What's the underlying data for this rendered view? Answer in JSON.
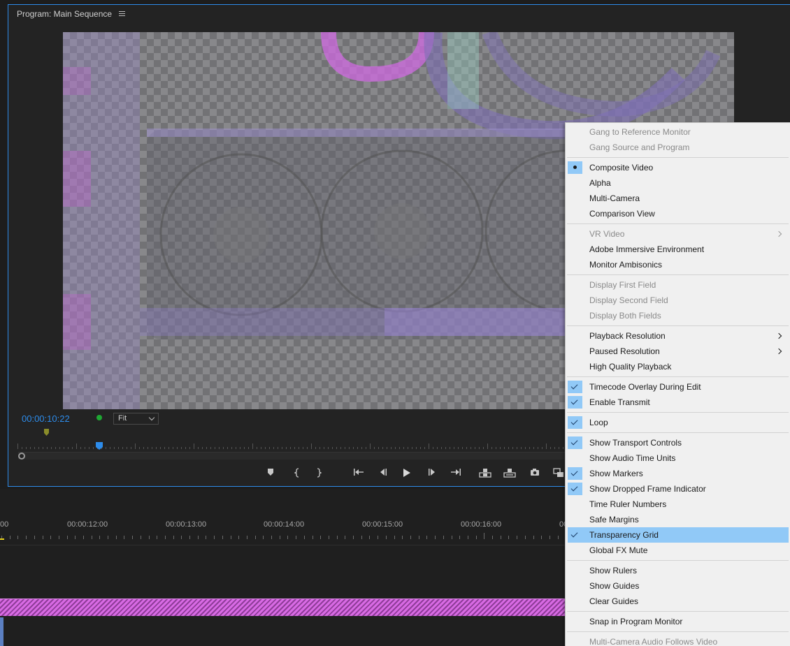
{
  "panel": {
    "title": "Program: Main Sequence"
  },
  "playback": {
    "timecode": "00:00:10:22",
    "zoom": "Fit"
  },
  "timeline": {
    "labels": [
      "00",
      "00:00:12:00",
      "00:00:13:00",
      "00:00:14:00",
      "00:00:15:00",
      "00:00:16:00",
      "00"
    ]
  },
  "menu": {
    "groups": [
      [
        {
          "label": "Gang to Reference Monitor",
          "disabled": true
        },
        {
          "label": "Gang Source and Program",
          "disabled": true
        }
      ],
      [
        {
          "label": "Composite Video",
          "mark": "dot"
        },
        {
          "label": "Alpha"
        },
        {
          "label": "Multi-Camera"
        },
        {
          "label": "Comparison View"
        }
      ],
      [
        {
          "label": "VR Video",
          "disabled": true,
          "submenu": true
        },
        {
          "label": "Adobe Immersive Environment"
        },
        {
          "label": "Monitor Ambisonics"
        }
      ],
      [
        {
          "label": "Display First Field",
          "disabled": true
        },
        {
          "label": "Display Second Field",
          "disabled": true
        },
        {
          "label": "Display Both Fields",
          "disabled": true
        }
      ],
      [
        {
          "label": "Playback Resolution",
          "submenu": true
        },
        {
          "label": "Paused Resolution",
          "submenu": true
        },
        {
          "label": "High Quality Playback"
        }
      ],
      [
        {
          "label": "Timecode Overlay During Edit",
          "mark": "check"
        },
        {
          "label": "Enable Transmit",
          "mark": "check"
        }
      ],
      [
        {
          "label": "Loop",
          "mark": "check"
        }
      ],
      [
        {
          "label": "Show Transport Controls",
          "mark": "check"
        },
        {
          "label": "Show Audio Time Units"
        },
        {
          "label": "Show Markers",
          "mark": "check"
        },
        {
          "label": "Show Dropped Frame Indicator",
          "mark": "check"
        },
        {
          "label": "Time Ruler Numbers"
        },
        {
          "label": "Safe Margins"
        },
        {
          "label": "Transparency Grid",
          "mark": "check",
          "highlighted": true
        },
        {
          "label": "Global FX Mute"
        }
      ],
      [
        {
          "label": "Show Rulers"
        },
        {
          "label": "Show Guides"
        },
        {
          "label": "Clear Guides"
        }
      ],
      [
        {
          "label": "Snap in Program Monitor"
        }
      ],
      [
        {
          "label": "Multi-Camera Audio Follows Video",
          "disabled": true
        }
      ]
    ]
  },
  "transport_icons": [
    "add-marker-icon",
    "mark-in-icon",
    "mark-out-icon",
    "go-to-in-icon",
    "step-back-icon",
    "play-icon",
    "step-forward-icon",
    "go-to-out-icon",
    "lift-icon",
    "extract-icon",
    "export-frame-icon",
    "comparison-view-icon"
  ],
  "colors": {
    "accent": "#2d8ceb",
    "highlight": "#91c9f7",
    "clip": "#d86ae4"
  }
}
